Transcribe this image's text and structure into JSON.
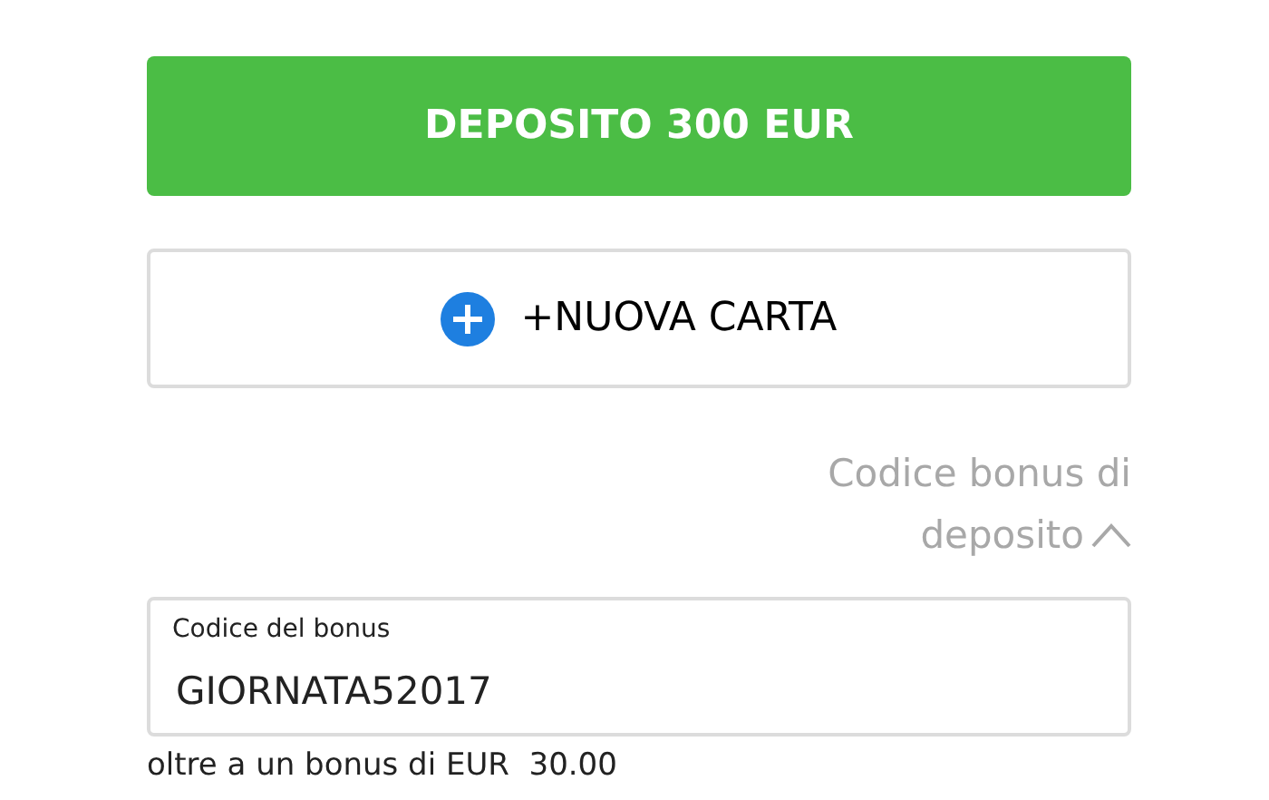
{
  "deposit_button": {
    "label": "DEPOSITO 300 EUR"
  },
  "new_card_button": {
    "label": "+NUOVA CARTA"
  },
  "bonus_toggle": {
    "label_line_1": "Codice bonus di",
    "label_line_2": "deposito",
    "expanded": true
  },
  "bonus_field": {
    "label": "Codice del bonus",
    "value": "GIORNATA52017"
  },
  "bonus_note": "oltre a un bonus di EUR  30.00"
}
